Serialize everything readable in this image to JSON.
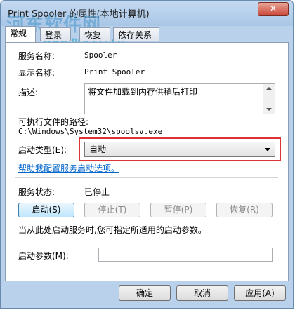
{
  "window": {
    "title": "Print Spooler 的属性(本地计算机)",
    "close_glyph": "✕"
  },
  "watermark": {
    "text": "河东软件网",
    "url": "www.pc0359.cn"
  },
  "tabs": [
    {
      "label": "常规",
      "active": true
    },
    {
      "label": "登录",
      "active": false
    },
    {
      "label": "恢复",
      "active": false
    },
    {
      "label": "依存关系",
      "active": false
    }
  ],
  "general": {
    "service_name_label": "服务名称:",
    "service_name_value": "Spooler",
    "display_name_label": "显示名称:",
    "display_name_value": "Print Spooler",
    "description_label": "描述:",
    "description_value": "将文件加载到内存供稍后打印",
    "exec_path_label": "可执行文件的路径:",
    "exec_path_value": "C:\\Windows\\System32\\spoolsv.exe",
    "startup_type_label": "启动类型(E):",
    "startup_type_value": "自动",
    "help_link": "帮助我配置服务启动选项。",
    "status_label": "服务状态:",
    "status_value": "已停止",
    "start_button": "启动(S)",
    "stop_button": "停止(T)",
    "pause_button": "暂停(P)",
    "resume_button": "恢复(R)",
    "hint_text": "当从此处启动服务时,您可指定所适用的启动参数。",
    "params_label": "启动参数(M):",
    "params_value": ""
  },
  "footer": {
    "ok_button": "确定",
    "cancel_button": "取消",
    "apply_button": "应用(A)"
  },
  "colors": {
    "highlight_frame": "#dd3333",
    "link": "#0066cc"
  }
}
